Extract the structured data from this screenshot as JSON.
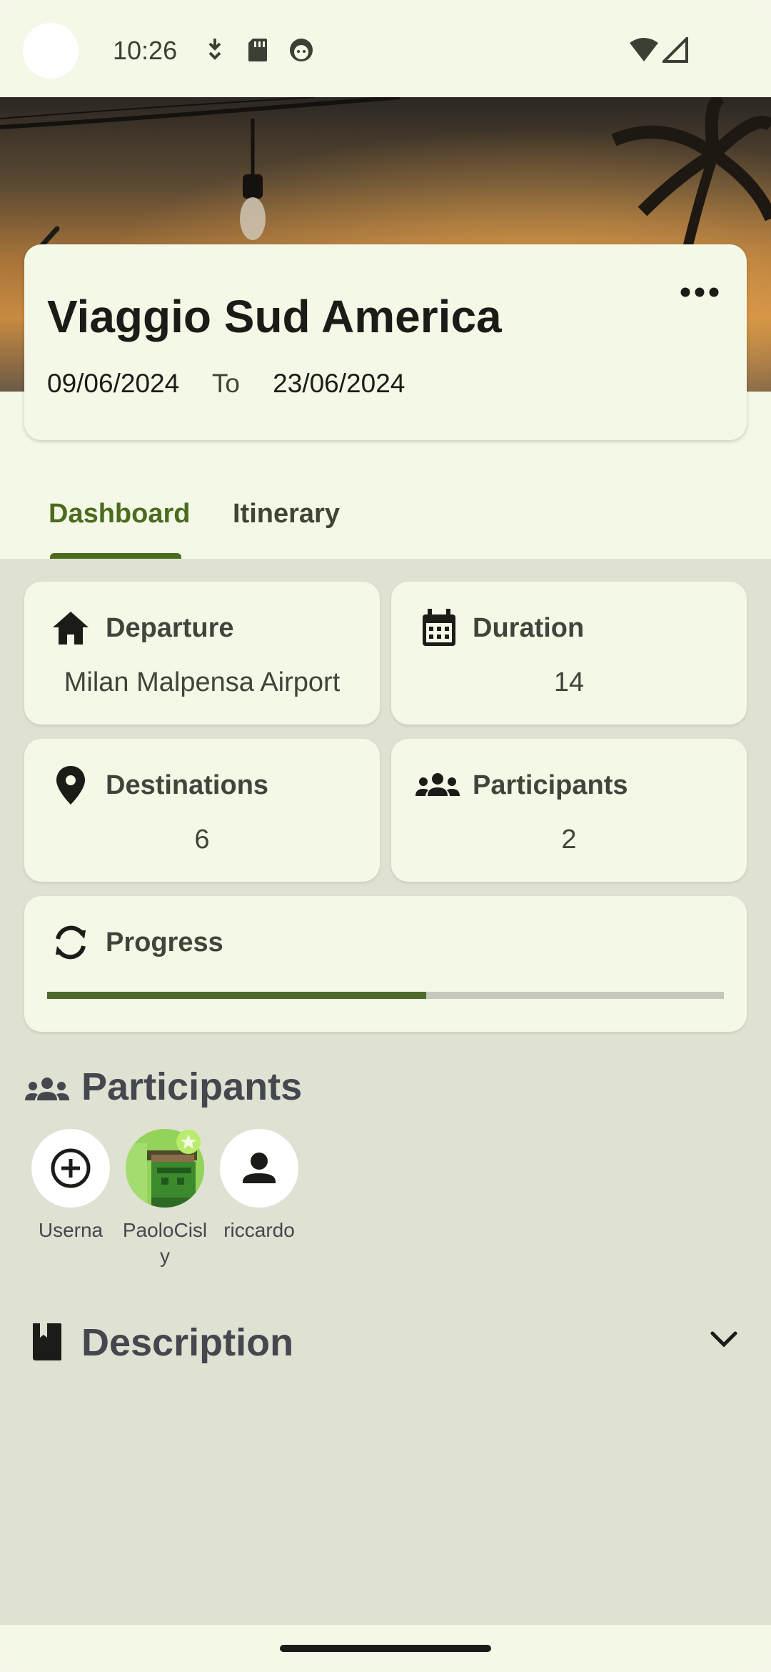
{
  "status_bar": {
    "time": "10:26",
    "icons": [
      "download-icon",
      "sd-card-icon",
      "face-icon",
      "wifi-icon",
      "signal-icon"
    ]
  },
  "header": {
    "back_icon": "arrow-back-icon",
    "more_icon": "more-horizontal-icon"
  },
  "trip": {
    "title": "Viaggio Sud America",
    "start_date": "09/06/2024",
    "to_label": "To",
    "end_date": "23/06/2024"
  },
  "tabs": [
    {
      "label": "Dashboard",
      "selected": true
    },
    {
      "label": "Itinerary",
      "selected": false
    }
  ],
  "stats": {
    "departure": {
      "label": "Departure",
      "value": "Milan Malpensa Airport",
      "icon": "home-icon"
    },
    "duration": {
      "label": "Duration",
      "value": "14",
      "icon": "calendar-icon"
    },
    "destinations": {
      "label": "Destinations",
      "value": "6",
      "icon": "location-pin-icon"
    },
    "participants": {
      "label": "Participants",
      "value": "2",
      "icon": "group-icon"
    }
  },
  "progress": {
    "label": "Progress",
    "icon": "sync-icon",
    "fraction": 0.56
  },
  "participants_section": {
    "title": "Participants",
    "icon": "group-icon",
    "people": [
      {
        "label": "Userna",
        "icon": "add-circle-icon"
      },
      {
        "label": "PaoloCisly",
        "icon": "pixel-avatar-icon"
      },
      {
        "label": "riccardo",
        "icon": "person-icon"
      }
    ]
  },
  "description_section": {
    "title": "Description",
    "icon": "book-icon",
    "expand_icon": "chevron-down-icon"
  },
  "colors": {
    "accent": "#4c6b1e",
    "surface": "#f4f8e6",
    "background": "#dfe1d2"
  }
}
